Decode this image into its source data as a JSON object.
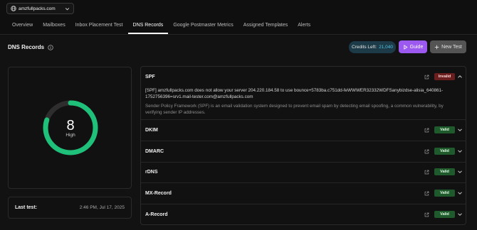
{
  "header": {
    "domain": "amzfullpacks.com",
    "tabs": [
      {
        "label": "Overview"
      },
      {
        "label": "Mailboxes"
      },
      {
        "label": "Inbox Placement Test"
      },
      {
        "label": "DNS Records"
      },
      {
        "label": "Google Postmaster Metrics"
      },
      {
        "label": "Assigned Templates"
      },
      {
        "label": "Alerts"
      }
    ],
    "active_tab": "DNS Records"
  },
  "page": {
    "title": "DNS Records",
    "credits_label": "Credits Left:",
    "credits_value": "21,040",
    "guide_label": "Guide",
    "new_test_label": "New Test"
  },
  "score": {
    "value": "8",
    "label": "High",
    "fraction": 0.8,
    "ring_color": "#1ec07a"
  },
  "last_test": {
    "label": "Last test:",
    "value": "2:46 PM, Jul 17, 2025"
  },
  "records": [
    {
      "name": "SPF",
      "status": "Invalid",
      "expanded": true,
      "warning": "[SPF] amzfullpacks.com does not allow your server 204.220.184.58 to use bounce+5783ba.c751dd-feWWWER32332WDFSanybizdse-alisia_640861-1752756396=srv1.mail-tester.com@amzfullpacks.com",
      "description": "Sender Policy Framework (SPF) is an email validation system designed to prevent email spam by detecting email spoofing, a common vulnerability, by verifying sender IP addresses."
    },
    {
      "name": "DKIM",
      "status": "Valid",
      "expanded": false
    },
    {
      "name": "DMARC",
      "status": "Valid",
      "expanded": false
    },
    {
      "name": "rDNS",
      "status": "Valid",
      "expanded": false
    },
    {
      "name": "MX-Record",
      "status": "Valid",
      "expanded": false
    },
    {
      "name": "A-Record",
      "status": "Valid",
      "expanded": false
    }
  ],
  "icons": {
    "domain": "globe-icon",
    "dropdown": "chevron-down-icon",
    "info": "info-icon",
    "guide": "play-icon",
    "new_test": "plus-icon",
    "open": "external-link-icon",
    "expand": "chevron-down-icon",
    "collapse": "chevron-up-icon"
  },
  "colors": {
    "accent": "#9b59f0",
    "valid": "#1e5a2c",
    "invalid": "#6a1e1e",
    "credits": "#4fc3e0"
  }
}
